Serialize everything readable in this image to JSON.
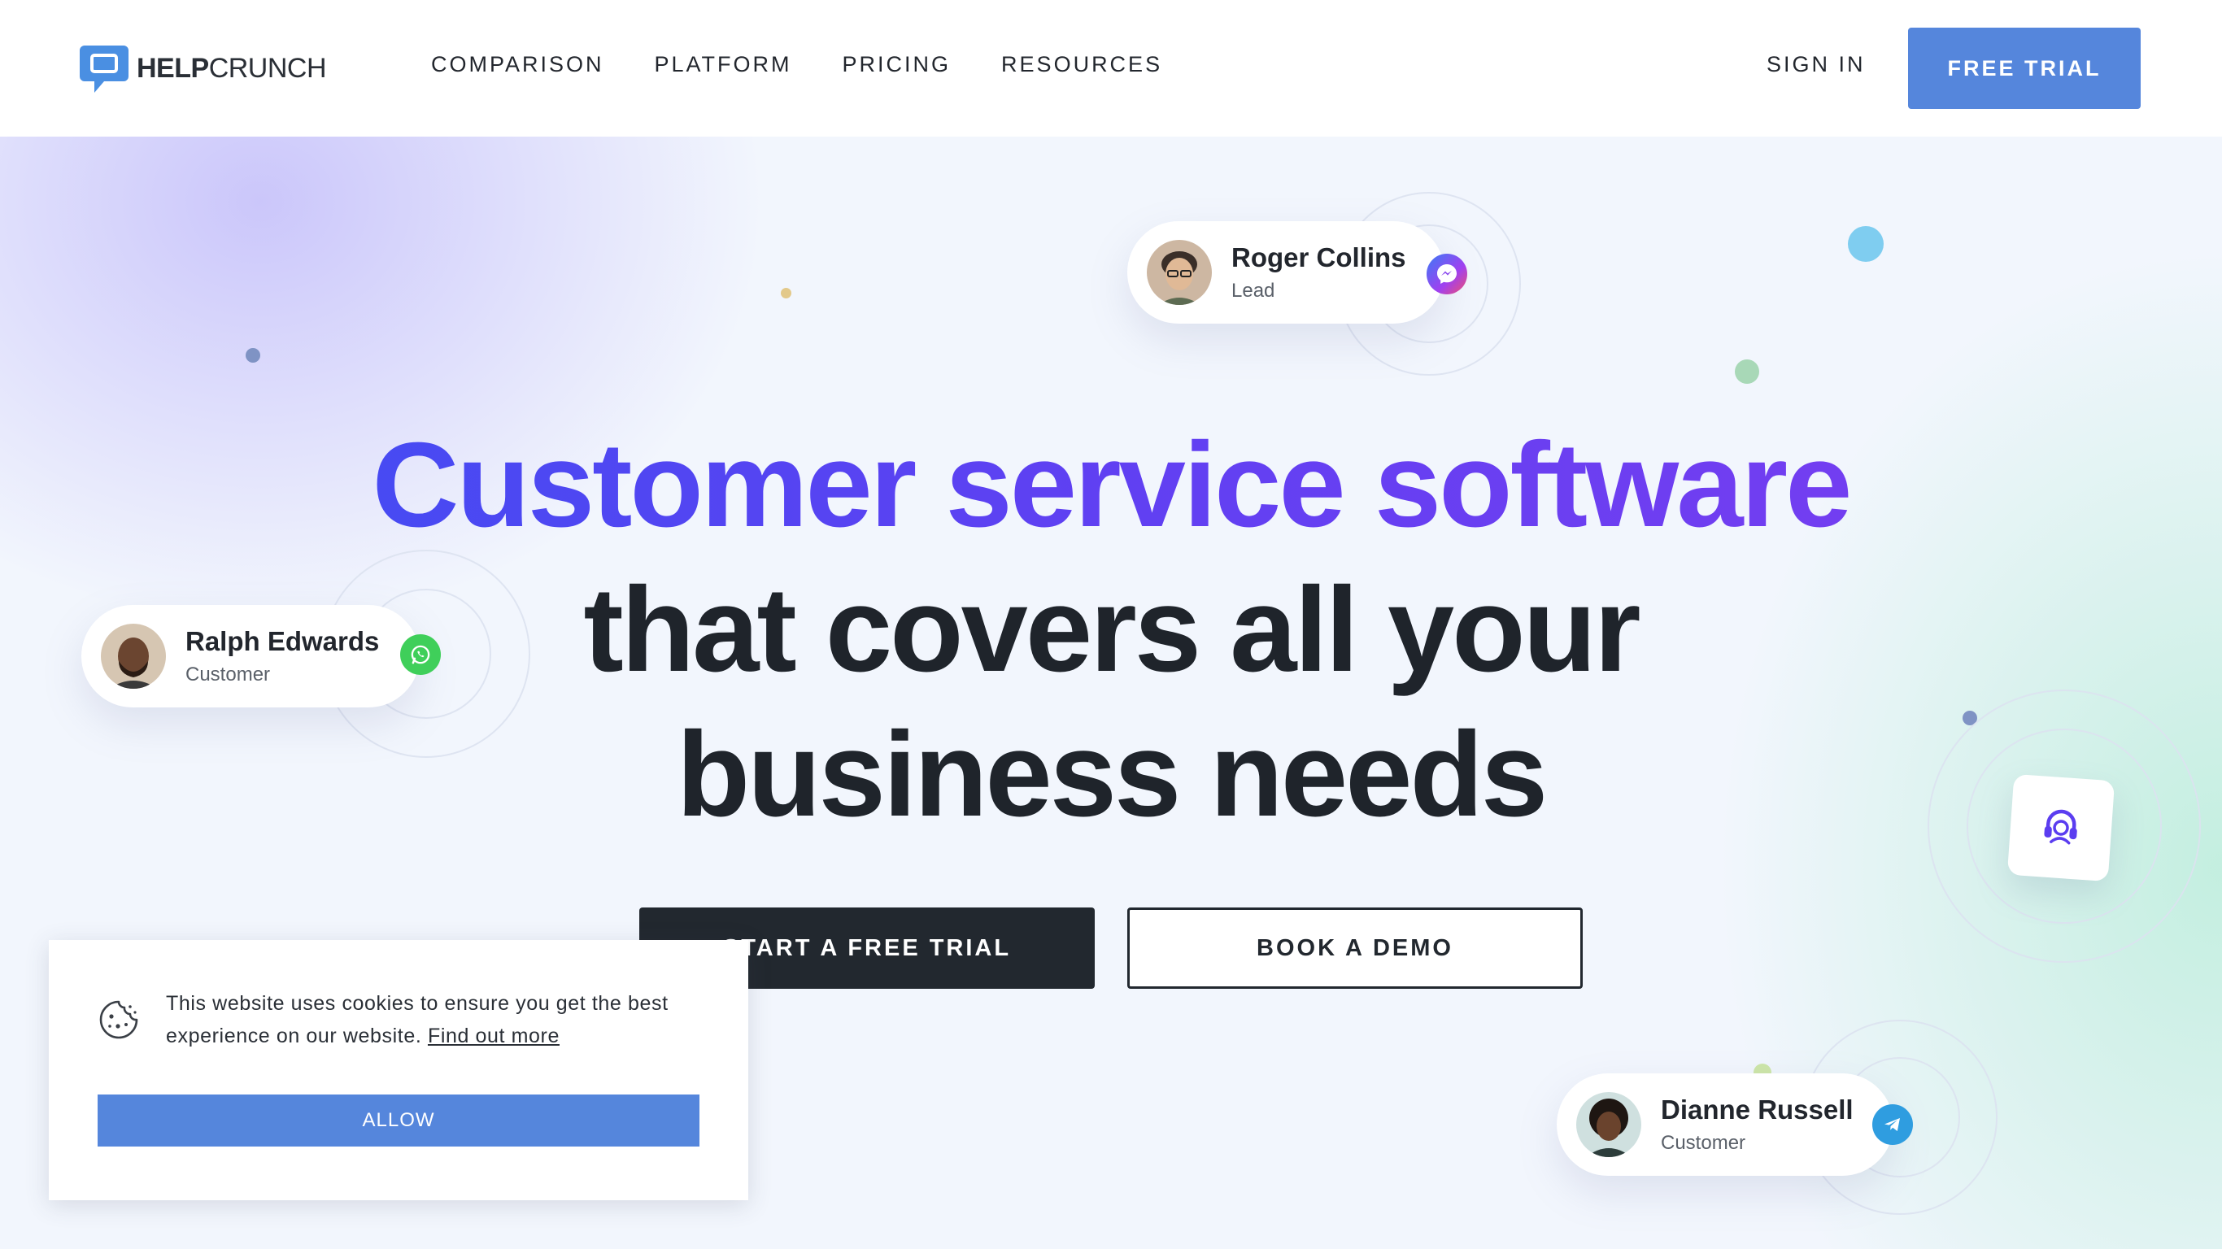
{
  "header": {
    "logo": {
      "bold": "HELP",
      "regular": "CRUNCH"
    },
    "nav": [
      {
        "label": "COMPARISON"
      },
      {
        "label": "PLATFORM"
      },
      {
        "label": "PRICING"
      },
      {
        "label": "RESOURCES"
      }
    ],
    "sign_in": "SIGN IN",
    "free_trial": "FREE TRIAL"
  },
  "hero": {
    "headline_line1": "Customer service software",
    "headline_line2": "that covers all your",
    "headline_line3": "business needs",
    "cta_primary": "START A FREE TRIAL",
    "cta_secondary": "BOOK A DEMO"
  },
  "cards": [
    {
      "name": "Roger Collins",
      "role": "Lead",
      "channel_icon": "messenger-icon"
    },
    {
      "name": "Ralph Edwards",
      "role": "Customer",
      "channel_icon": "whatsapp-icon"
    },
    {
      "name": "Dianne Russell",
      "role": "Customer",
      "channel_icon": "telegram-icon"
    }
  ],
  "cookie": {
    "message": "This website uses cookies to ensure you get the best experience on our website.",
    "link": "Find out more",
    "allow": "ALLOW"
  },
  "colors": {
    "accent": "#5586dc",
    "dark": "#22282f",
    "headline_gradient_start": "#3b4ff3",
    "headline_gradient_end": "#7c3df0"
  }
}
